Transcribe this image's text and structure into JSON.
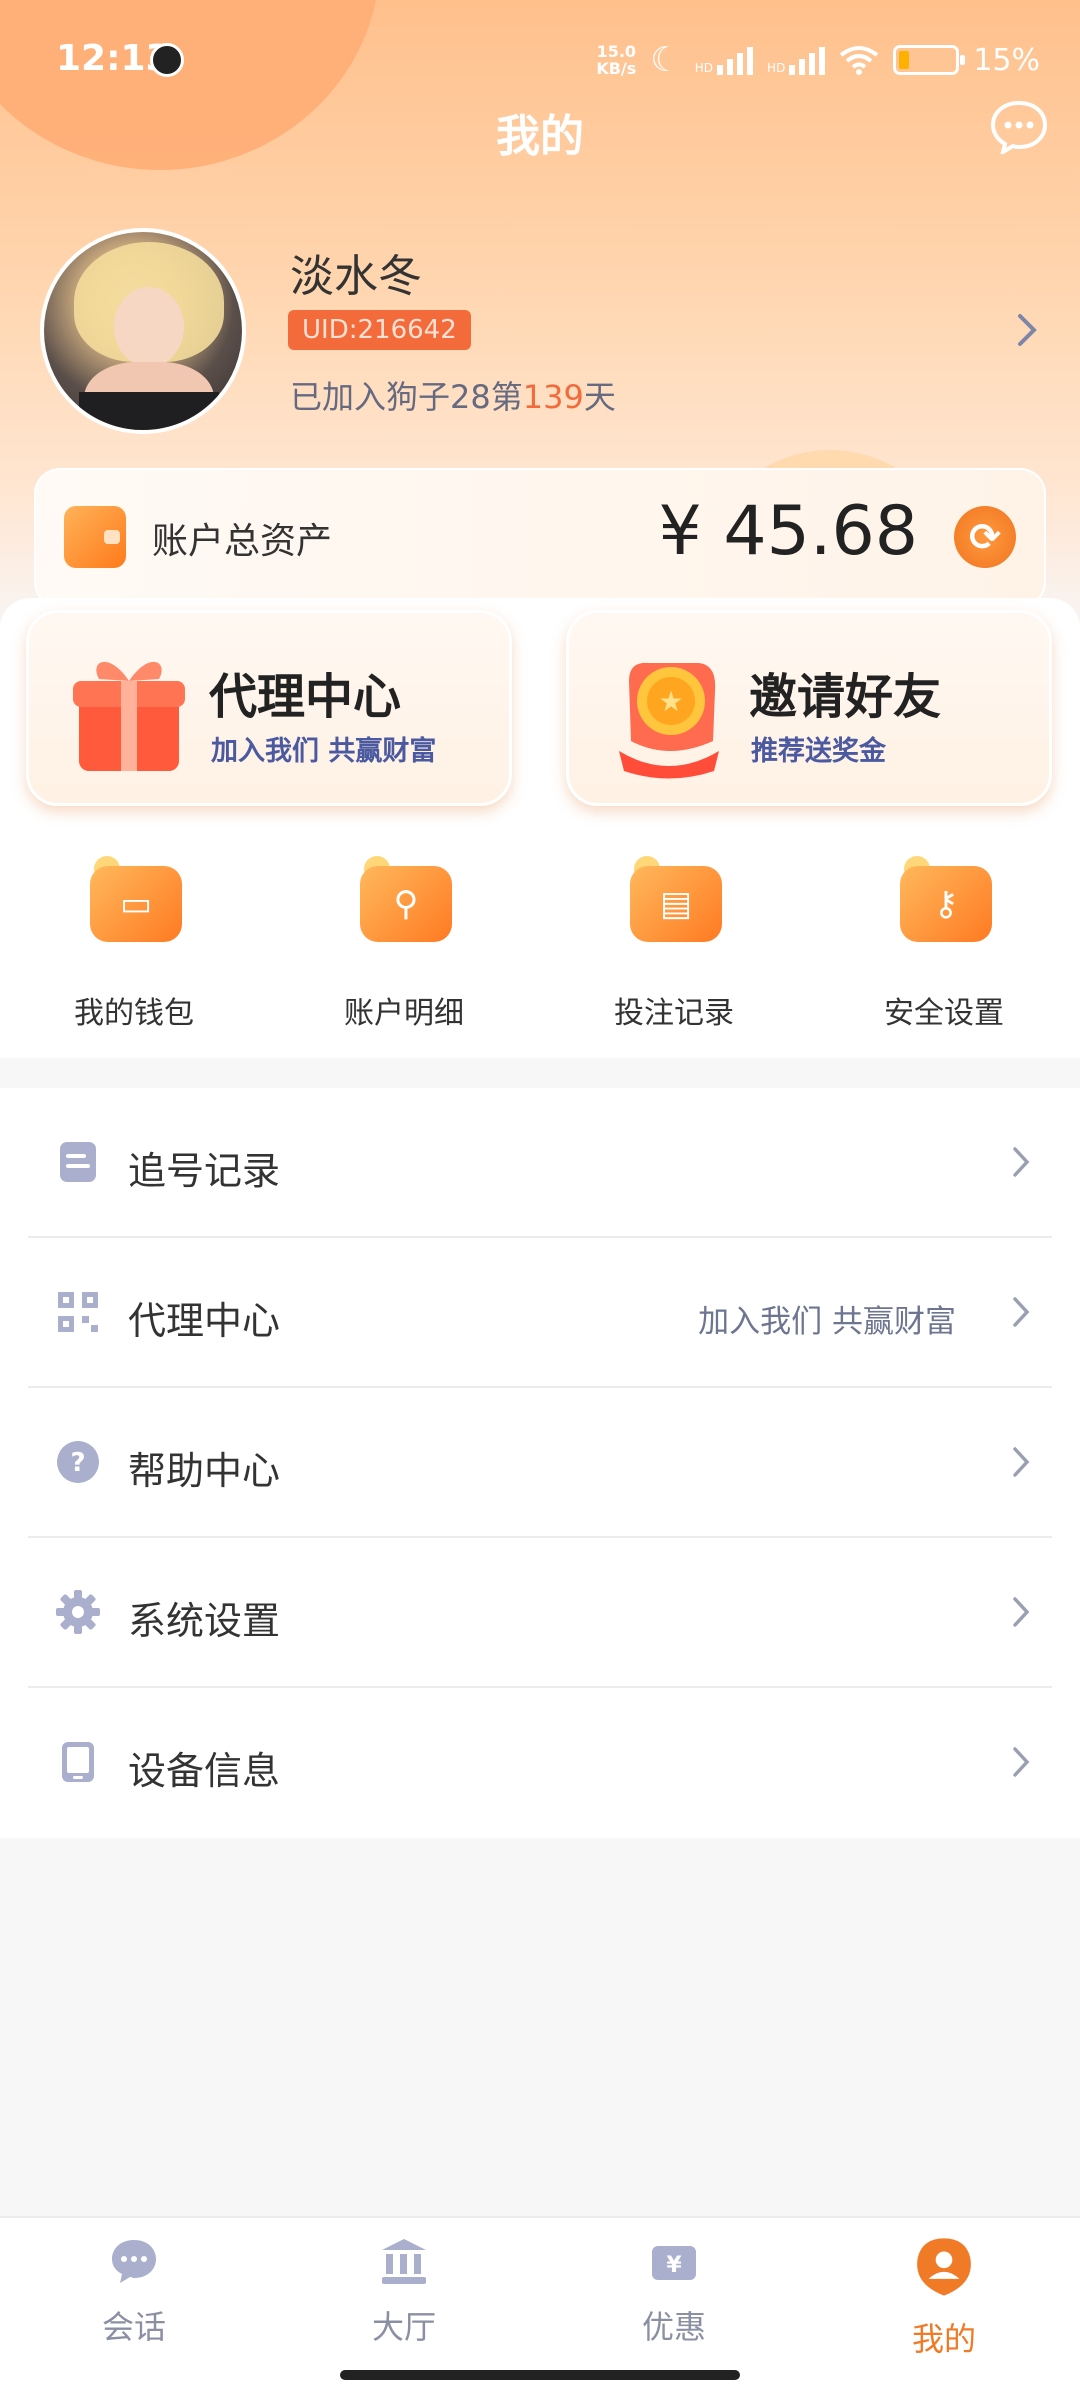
{
  "status_bar": {
    "time": "12:13",
    "net_speed_value": "15.0",
    "net_speed_unit": "KB/s",
    "signal1_label": "HD",
    "signal2_label": "HD",
    "battery": "15%"
  },
  "header": {
    "title": "我的",
    "message_icon": "chat-bubble-icon"
  },
  "profile": {
    "name": "淡水冬",
    "uid": "UID:216642",
    "joined_prefix": "已加入狗子28第",
    "joined_days": "139",
    "joined_suffix": "天"
  },
  "assets": {
    "label": "账户总资产",
    "amount": "¥ 45.68"
  },
  "promos": [
    {
      "title": "代理中心",
      "subtitle": "加入我们 共赢财富",
      "icon": "gift-icon"
    },
    {
      "title": "邀请好友",
      "subtitle": "推荐送奖金",
      "icon": "coin-hand-icon"
    }
  ],
  "quick_actions": [
    {
      "label": "我的钱包",
      "icon": "wallet-icon"
    },
    {
      "label": "账户明细",
      "icon": "magnifier-icon"
    },
    {
      "label": "投注记录",
      "icon": "record-icon"
    },
    {
      "label": "安全设置",
      "icon": "key-icon"
    }
  ],
  "menu": [
    {
      "label": "追号记录",
      "extra": "",
      "icon": "clipboard-icon"
    },
    {
      "label": "代理中心",
      "extra": "加入我们 共赢财富",
      "icon": "qr-code-icon"
    },
    {
      "label": "帮助中心",
      "extra": "",
      "icon": "help-icon"
    },
    {
      "label": "系统设置",
      "extra": "",
      "icon": "gear-icon"
    },
    {
      "label": "设备信息",
      "extra": "",
      "icon": "device-icon"
    }
  ],
  "bottom_nav": [
    {
      "label": "会话",
      "icon": "chat-icon",
      "active": false
    },
    {
      "label": "大厅",
      "icon": "bank-icon",
      "active": false
    },
    {
      "label": "优惠",
      "icon": "yen-ticket-icon",
      "active": false
    },
    {
      "label": "我的",
      "icon": "user-icon",
      "active": true
    }
  ],
  "colors": {
    "accent": "#f07a26",
    "uid_badge": "#f36a3b",
    "subtitle": "#4b5aa0"
  }
}
